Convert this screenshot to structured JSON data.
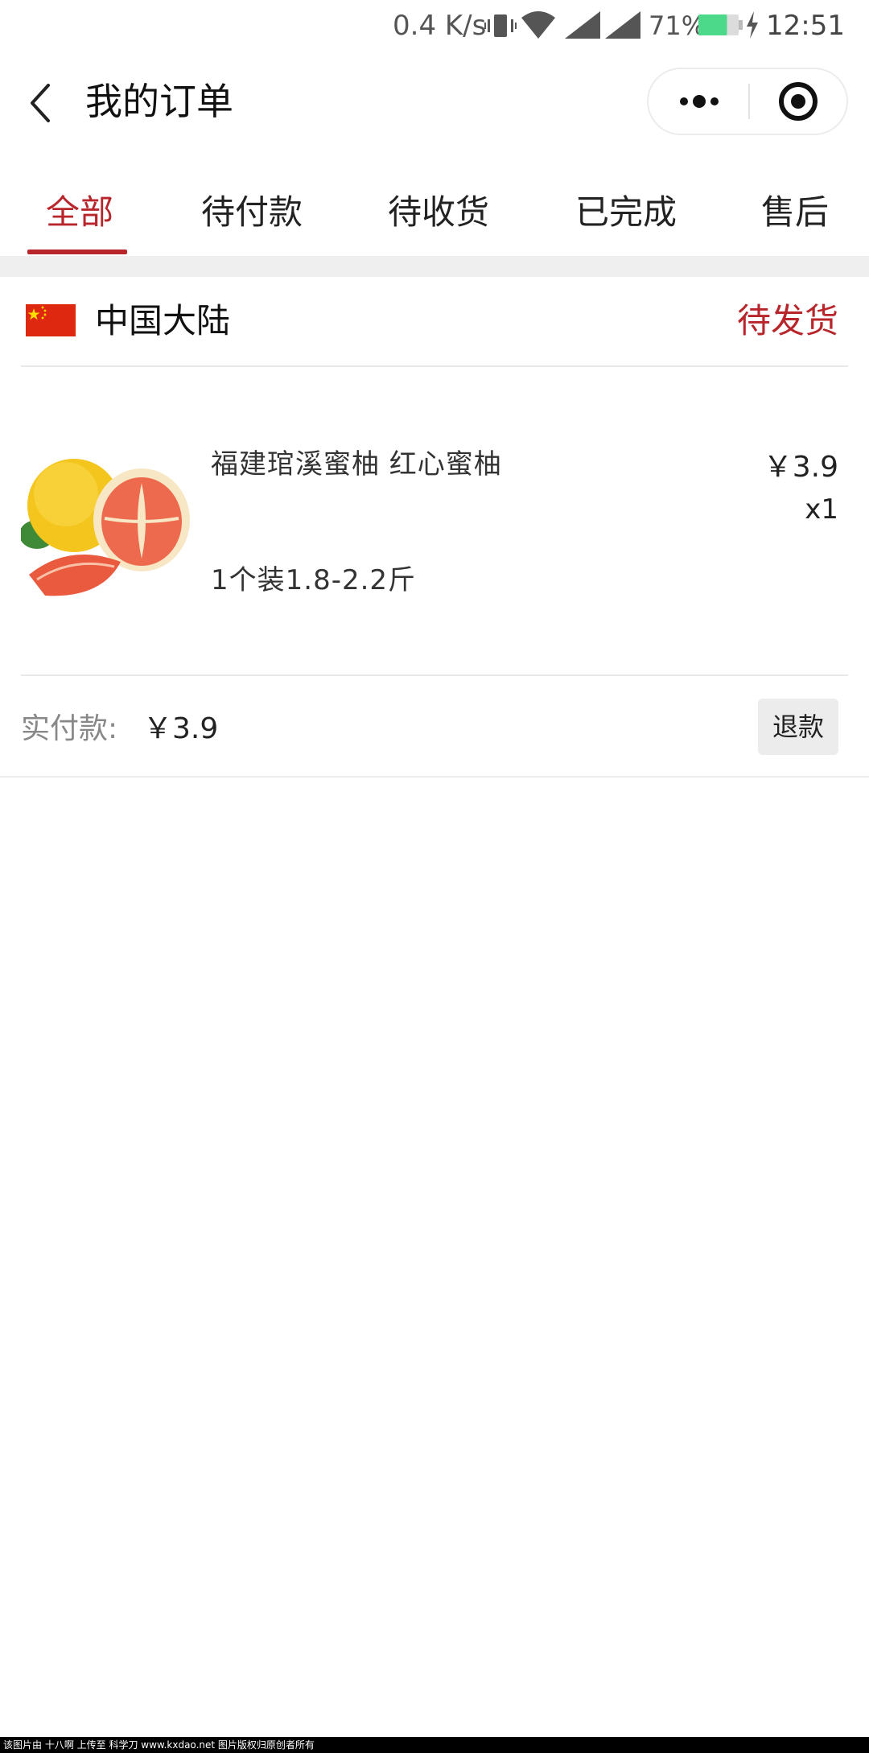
{
  "status_bar": {
    "net_speed": "0.4 K/s",
    "battery_percent": "71%",
    "battery_level": 0.71,
    "battery_color": "#4cd98a",
    "time": "12:51",
    "icons": [
      "vibrate-icon",
      "wifi-icon",
      "signal-icon",
      "signal-icon",
      "battery-icon",
      "charging-icon"
    ]
  },
  "nav": {
    "title": "我的订单",
    "back_icon": "chevron-left-icon",
    "more_icon": "more-dots-icon",
    "close_icon": "target-close-icon"
  },
  "tabs": [
    {
      "label": "全部",
      "active": true
    },
    {
      "label": "待付款",
      "active": false
    },
    {
      "label": "待收货",
      "active": false
    },
    {
      "label": "已完成",
      "active": false
    },
    {
      "label": "售后",
      "active": false
    }
  ],
  "accent_color": "#b8262b",
  "order": {
    "region": "中国大陆",
    "region_flag": "china-flag-icon",
    "status": "待发货",
    "product": {
      "name": "福建琯溪蜜柚 红心蜜柚",
      "spec": "1个装1.8-2.2斤",
      "price": "￥3.9",
      "quantity": "x1",
      "image": "pomelo-image"
    },
    "paid_label": "实付款:",
    "paid_value": "￥3.9",
    "refund_label": "退款"
  },
  "watermark": "该图片由 十八啊 上传至 科学刀 www.kxdao.net 图片版权归原创者所有"
}
